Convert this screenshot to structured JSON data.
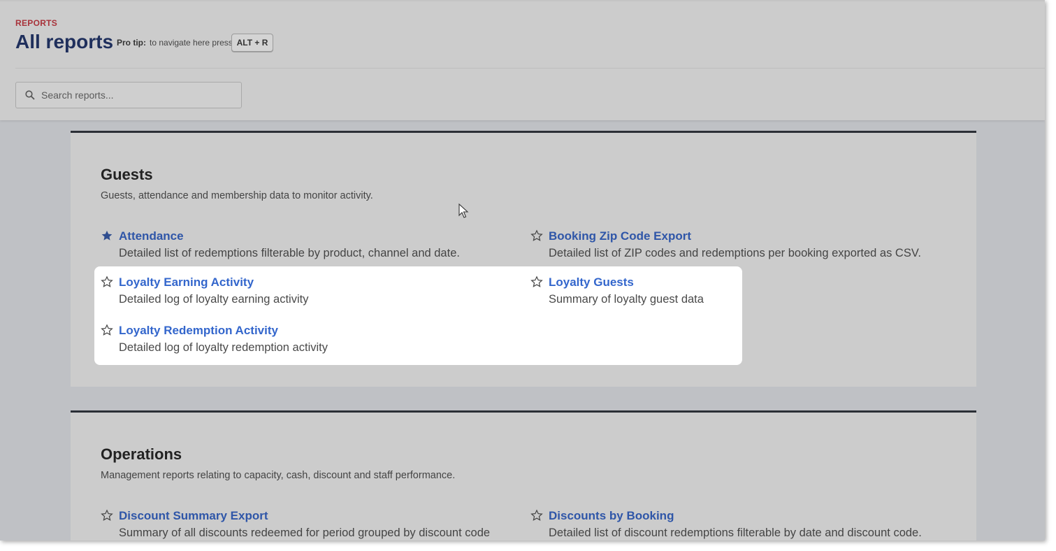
{
  "header": {
    "breadcrumb": "REPORTS",
    "title": "All reports",
    "protip_label": "Pro tip:",
    "protip_text": "to navigate here press",
    "shortcut": "ALT + R"
  },
  "search": {
    "placeholder": "Search reports...",
    "value": ""
  },
  "sections": [
    {
      "title": "Guests",
      "description": "Guests, attendance and membership data to monitor activity.",
      "reports": [
        {
          "name": "Attendance",
          "description": "Detailed list of redemptions filterable by product, channel and date.",
          "favorite": true,
          "icon": "star-filled-icon"
        },
        {
          "name": "Booking Zip Code Export",
          "description": "Detailed list of ZIP codes and redemptions per booking exported as CSV.",
          "favorite": false,
          "icon": "star-outline-icon"
        },
        {
          "name": "Loyalty Earning Activity",
          "description": "Detailed log of loyalty earning activity",
          "favorite": false,
          "icon": "star-outline-icon"
        },
        {
          "name": "Loyalty Guests",
          "description": "Summary of loyalty guest data",
          "favorite": false,
          "icon": "star-outline-icon"
        },
        {
          "name": "Loyalty Redemption Activity",
          "description": "Detailed log of loyalty redemption activity",
          "favorite": false,
          "icon": "star-outline-icon"
        }
      ]
    },
    {
      "title": "Operations",
      "description": "Management reports relating to capacity, cash, discount and staff performance.",
      "reports": [
        {
          "name": "Discount Summary Export",
          "description": "Summary of all discounts redeemed for period grouped by discount code",
          "favorite": false,
          "icon": "star-outline-icon"
        },
        {
          "name": "Discounts by Booking",
          "description": "Detailed list of discount redemptions filterable by date and discount code.",
          "favorite": false,
          "icon": "star-outline-icon"
        }
      ]
    }
  ],
  "colors": {
    "breadcrumb": "#a8323a",
    "title": "#1f2f5c",
    "link": "#2f56a8",
    "section_border": "#2b2f36"
  }
}
